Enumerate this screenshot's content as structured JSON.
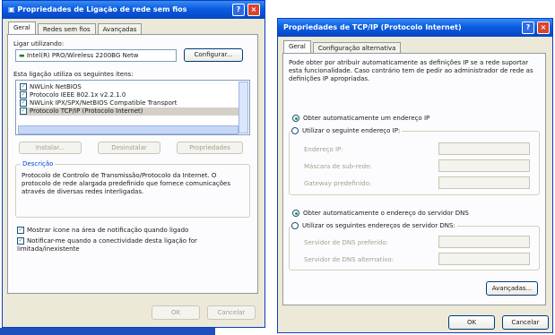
{
  "left_dialog": {
    "title": "Propriedades de Ligação de rede sem fios",
    "tabs": [
      {
        "label": "Geral"
      },
      {
        "label": "Redes sem fios"
      },
      {
        "label": "Avançadas"
      }
    ],
    "connect_using_label": "Ligar utilizando:",
    "adapter_name": "Intel(R) PRO/Wireless 2200BG Netw",
    "configure_label": "Configurar...",
    "items_label": "Esta ligação utiliza os seguintes itens:",
    "items": [
      {
        "label": "NWLink NetBIOS"
      },
      {
        "label": "Protocolo IEEE 802.1x v2.2.1.0"
      },
      {
        "label": "NWLink IPX/SPX/NetBIOS Compatible Transport"
      },
      {
        "label": "Protocolo TCP/IP (Protocolo Internet)"
      }
    ],
    "install_label": "Instalar...",
    "uninstall_label": "Desinstalar",
    "properties_label": "Propriedades",
    "description_title": "Descrição",
    "description_text": "Protocolo de Controlo de Transmissão/Protocolo da Internet. O protocolo de rede alargada predefinido que fornece comunicações através de diversas redes interligadas.",
    "show_icon_label": "Mostrar ícone na área de notificação quando ligado",
    "notify_label": "Notificar-me quando a conectividade desta ligação for limitada/inexistente",
    "ok_label": "OK",
    "cancel_label": "Cancelar"
  },
  "right_dialog": {
    "title": "Propriedades de TCP/IP (Protocolo Internet)",
    "tabs": [
      {
        "label": "Geral"
      },
      {
        "label": "Configuração alternativa"
      }
    ],
    "intro_text": "Pode obter por atribuir automaticamente as definições IP se a rede suportar esta funcionalidade. Caso contrário tem de pedir ao administrador de rede as definições IP apropriadas.",
    "ip_auto_label": "Obter automaticamente um endereço IP",
    "ip_manual_label": "Utilizar o seguinte endereço IP:",
    "ip_address_label": "Endereço IP:",
    "subnet_label": "Máscara de sub-rede:",
    "gateway_label": "Gateway predefinido:",
    "dns_auto_label": "Obter automaticamente o endereço do servidor DNS",
    "dns_manual_label": "Utilizar os seguintes endereços de servidor DNS:",
    "dns_pref_label": "Servidor de DNS preferido:",
    "dns_alt_label": "Servidor de DNS alternativo:",
    "advanced_label": "Avançadas...",
    "ok_label": "OK",
    "cancel_label": "Cancelar"
  },
  "colors": {
    "titlebar": "#0a5ce0",
    "dialog_bg": "#ece9d8"
  }
}
